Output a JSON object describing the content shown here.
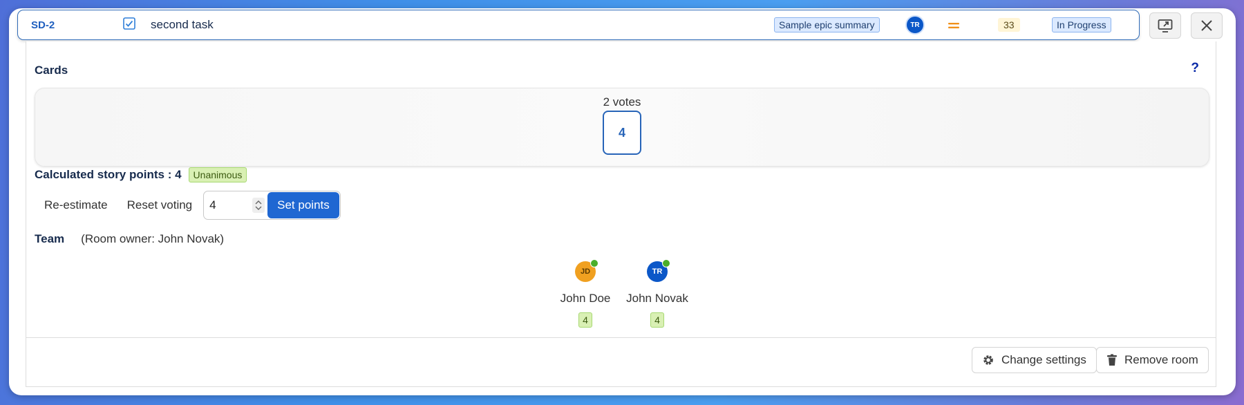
{
  "issue": {
    "key": "SD-2",
    "summary": "second task",
    "epic": "Sample epic summary",
    "assignee_initials": "TR",
    "priority_icon": "priority-medium-icon",
    "story_points": "33",
    "status": "In Progress"
  },
  "cards": {
    "title": "Cards",
    "help": "?",
    "votes_label": "2 votes",
    "card_value": "4"
  },
  "calculation": {
    "label": "Calculated story points : 4",
    "badge": "Unanimous"
  },
  "actions": {
    "reestimate": "Re-estimate",
    "reset": "Reset voting",
    "points_value": "4",
    "set_points": "Set points"
  },
  "team": {
    "label": "Team",
    "owner": "(Room owner: John Novak)",
    "members": [
      {
        "initials": "JD",
        "name": "John Doe",
        "vote": "4",
        "color": "#f0a020"
      },
      {
        "initials": "TR",
        "name": "John Novak",
        "vote": "4",
        "color": "#0b57c8"
      }
    ]
  },
  "footer": {
    "change_settings": "Change settings",
    "remove_room": "Remove room"
  },
  "colors": {
    "accent": "#1f67d2",
    "success_badge": "#d9f0b4"
  }
}
